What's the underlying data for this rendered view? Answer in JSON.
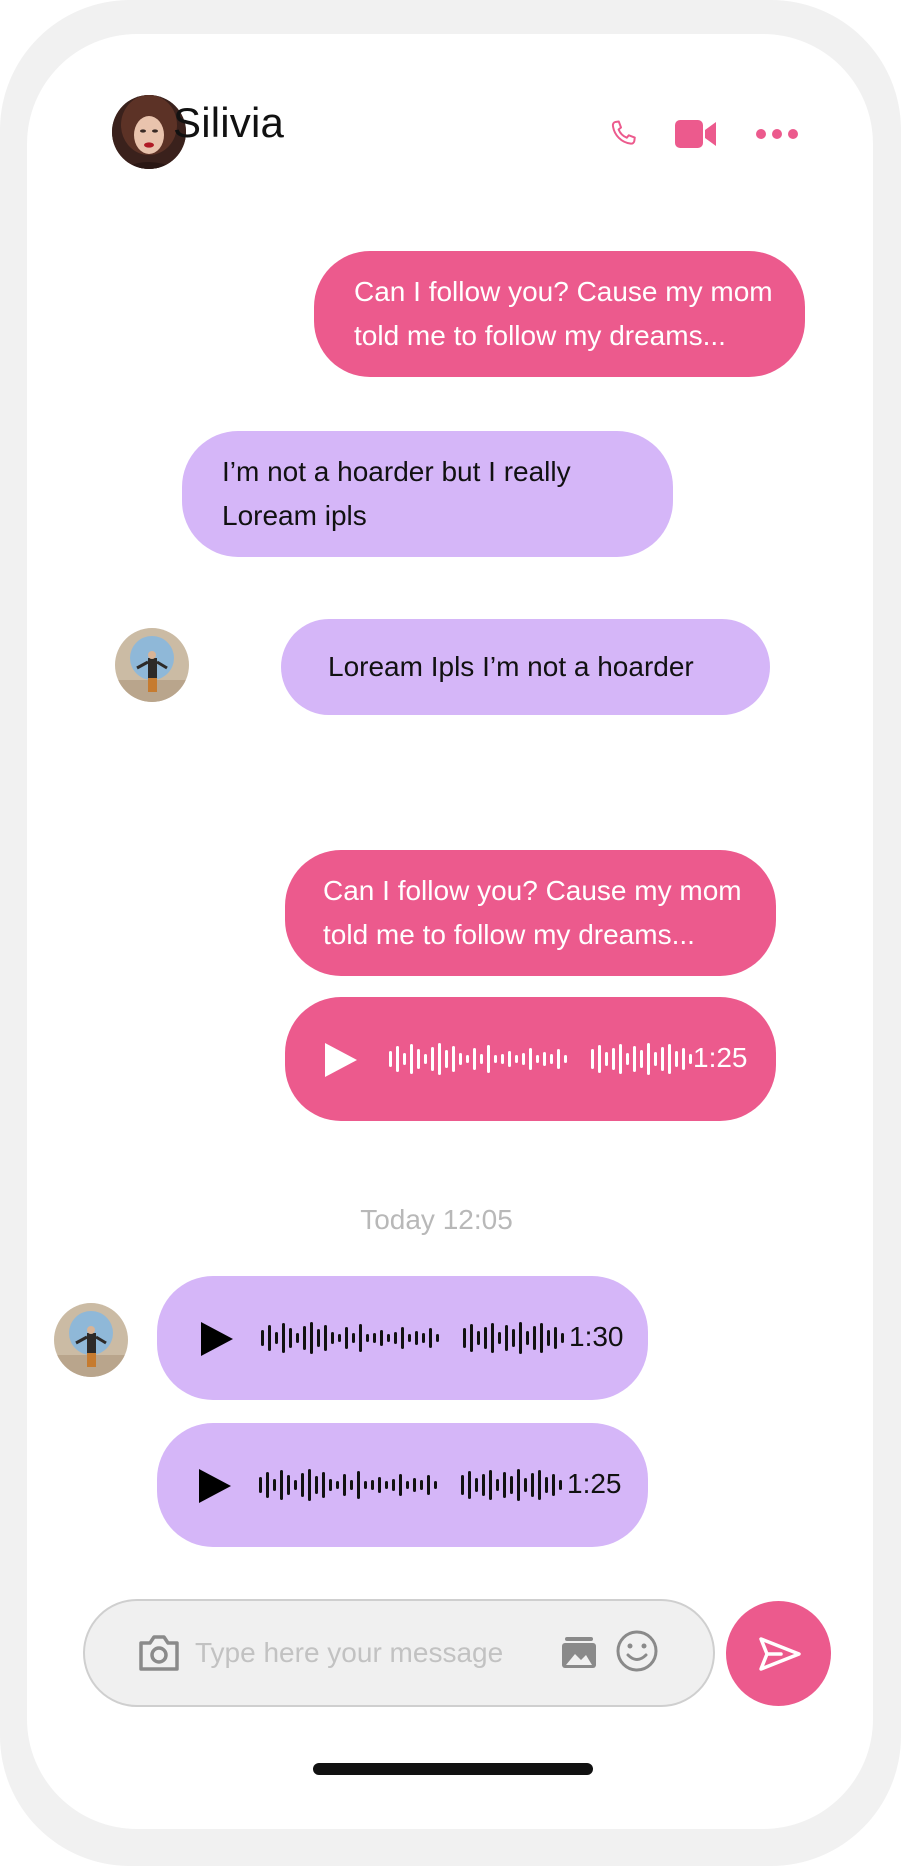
{
  "colors": {
    "accent": "#ec5a8d",
    "received_bubble": "#d5b6f8",
    "background": "#ffffff",
    "frame": "#f1f1f1"
  },
  "header": {
    "contact_name": "Silivia",
    "icons": [
      "phone-icon",
      "video-call-icon",
      "more-options-icon"
    ]
  },
  "messages": [
    {
      "type": "text",
      "side": "sent",
      "line1": "Can I follow you? Cause my mom",
      "line2": "told me to follow my dreams..."
    },
    {
      "type": "text",
      "side": "received",
      "line1": "I’m not a hoarder but I really",
      "line2": "Loream ipls"
    },
    {
      "type": "text",
      "side": "received",
      "text": "Loream Ipls I’m not a hoarder"
    },
    {
      "type": "text",
      "side": "sent",
      "line1": "Can I follow you? Cause my mom",
      "line2": "told me to follow my dreams..."
    },
    {
      "type": "voice",
      "side": "sent",
      "duration": "1:25"
    },
    {
      "type": "timestamp",
      "text": "Today 12:05"
    },
    {
      "type": "voice",
      "side": "received",
      "duration": "1:30"
    },
    {
      "type": "voice",
      "side": "received",
      "duration": "1:25"
    }
  ],
  "composer": {
    "placeholder": "Type here your message",
    "icons": [
      "camera-icon",
      "gallery-icon",
      "emoji-icon",
      "send-icon"
    ]
  }
}
